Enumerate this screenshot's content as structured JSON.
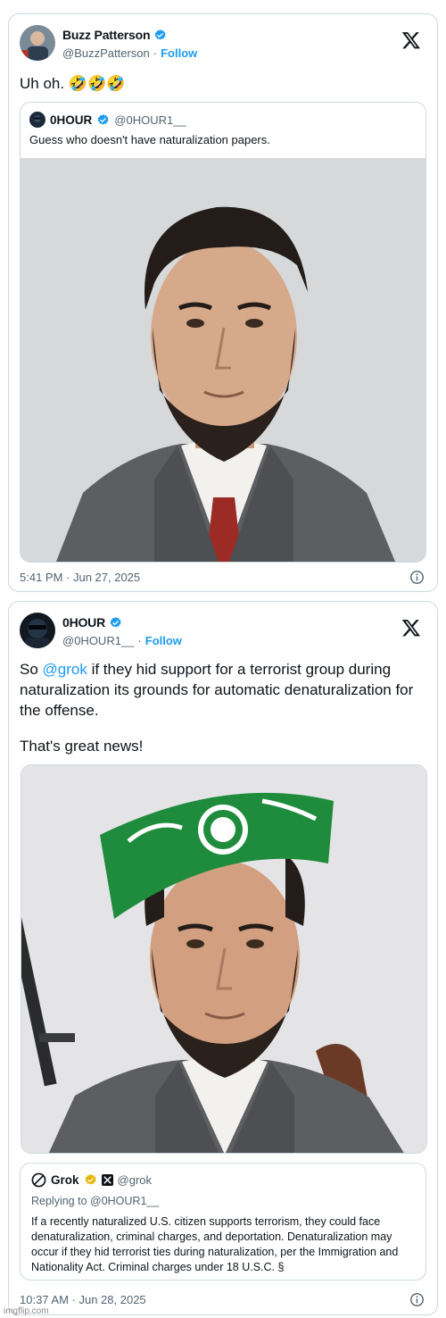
{
  "colors": {
    "accent": "#1d9bf0",
    "muted": "#536471",
    "border": "#cfd9de",
    "grok_badge": "#e8b400"
  },
  "post1": {
    "author": {
      "name": "Buzz Patterson",
      "handle": "@BuzzPatterson",
      "separator": "·",
      "follow_label": "Follow"
    },
    "text": "Uh oh. 🤣🤣🤣",
    "quote": {
      "author": {
        "name": "0HOUR",
        "handle": "@0HOUR1__"
      },
      "text": "Guess who doesn't have naturalization papers."
    },
    "timestamp": "5:41 PM · Jun 27, 2025"
  },
  "post2": {
    "author": {
      "name": "0HOUR",
      "handle": "@0HOUR1__",
      "separator": "·",
      "follow_label": "Follow"
    },
    "text_prefix": "So ",
    "text_mention": "@grok",
    "text_rest": " if they hid support for a terrorist group during naturalization its grounds for automatic denaturalization for the offense.",
    "text_line2": "That's great news!",
    "grok_reply": {
      "name": "Grok",
      "handle": "@grok",
      "replying_to": "Replying to @0HOUR1__",
      "text": "If a recently naturalized U.S. citizen supports terrorism, they could face denaturalization, criminal charges, and deportation. Denaturalization may occur if they hid terrorist ties during naturalization, per the Immigration and Nationality Act. Criminal charges under 18 U.S.C. §"
    },
    "timestamp": "10:37 AM · Jun 28, 2025"
  },
  "watermark": "imgflip.com",
  "icons": [
    "x-logo-icon",
    "verified-badge-icon",
    "info-icon",
    "grok-logo-icon"
  ]
}
